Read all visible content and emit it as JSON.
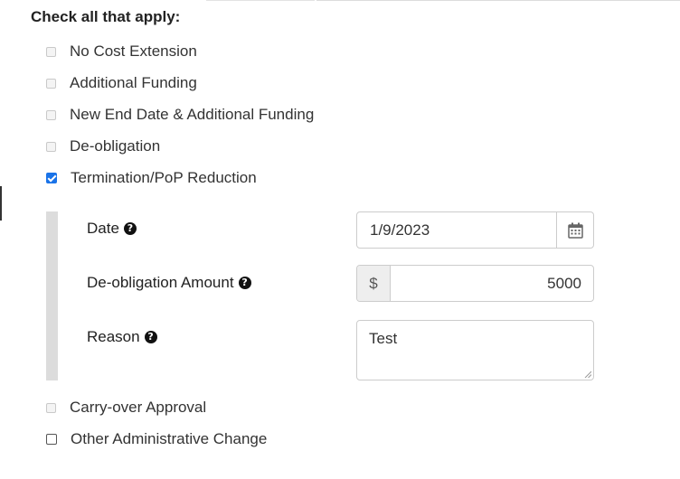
{
  "heading": "Check all that apply:",
  "options": [
    {
      "label": "No Cost Extension",
      "checked": false
    },
    {
      "label": "Additional Funding",
      "checked": false
    },
    {
      "label": "New End Date & Additional Funding",
      "checked": false
    },
    {
      "label": "De-obligation",
      "checked": false
    },
    {
      "label": "Termination/PoP Reduction",
      "checked": true
    }
  ],
  "termination_fields": {
    "date": {
      "label": "Date",
      "value": "1/9/2023",
      "icon": "calendar-icon"
    },
    "amount": {
      "label": "De-obligation Amount",
      "prefix": "$",
      "value": "5000"
    },
    "reason": {
      "label": "Reason",
      "value": "Test"
    },
    "help_icon": "?"
  },
  "options_after": [
    {
      "label": "Carry-over Approval",
      "checked": false
    },
    {
      "label": "Other Administrative Change",
      "checked": false
    }
  ],
  "colors": {
    "checkbox_checked": "#1a73e8",
    "addon_bg": "#eeeeee",
    "panel_bar": "#dcdcdc"
  }
}
